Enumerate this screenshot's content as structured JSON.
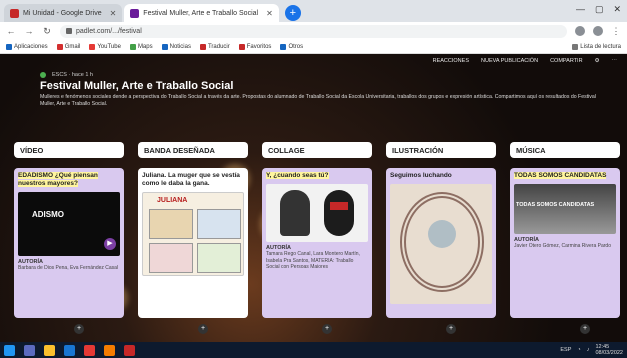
{
  "browser": {
    "tabs": [
      {
        "label": "Mi Unidad - Google Drive"
      },
      {
        "label": "Festival Muller, Arte e Traballo Social"
      }
    ],
    "address": "padlet.com/.../festival",
    "bookmarks": [
      "Aplicaciones",
      "Gmail",
      "YouTube",
      "Maps",
      "Noticias",
      "Traducir",
      "Favoritos",
      "Otros",
      "Lista de lectura"
    ]
  },
  "padlet": {
    "topbar": [
      "REACCIONES",
      "NUEVA PUBLICACIÓN",
      "COMPARTIR"
    ],
    "meta": "ESCS · hace 1 h",
    "title": "Festival Muller, Arte e Traballo Social",
    "description": "Mulleres e fenómenos sociales dende a perspectiva do Traballo Social a través da arte. Propostas do alumnado de Traballo Social da Escola Universitaria, traballos dos grupos e expresión artística. Compartimos aquí os resultados do Festival Muller, Arte e Traballo Social.",
    "columns": [
      {
        "header": "VÍDEO",
        "card_title": "EDADISMO ¿Qué piensan nuestros mayores?",
        "media_text": "ADISMO",
        "label": "AUTORÍA",
        "credits": "Barbara de Dios Pena, Eva Fernández Casal"
      },
      {
        "header": "BANDA DESEÑADA",
        "card_title": "Juliana. La muger que se vestía como le daba la gana.",
        "media_text": "JULIANA",
        "label": "",
        "credits": ""
      },
      {
        "header": "COLLAGE",
        "card_title": "Y, ¿cuando seas tú?",
        "media_text": "",
        "label": "AUTORÍA",
        "credits": "Tamara Rego Canal, Lara Montero Martín, Isabela Pra Santos, MATERIA: Traballo Social con Persoas Maiores"
      },
      {
        "header": "ILUSTRACIÓN",
        "card_title": "Seguimos luchando",
        "media_text": "",
        "label": "",
        "credits": ""
      },
      {
        "header": "MÚSICA",
        "card_title": "TODAS SOMOS CANDIDATAS",
        "media_text": "TODAS SOMOS CANDIDATAS",
        "label": "AUTORÍA",
        "credits": "Javier Otero Gómez, Carmina Rivera Pardo"
      }
    ]
  },
  "taskbar": {
    "time": "12:45",
    "date": "08/03/2022",
    "lang": "ESP"
  }
}
